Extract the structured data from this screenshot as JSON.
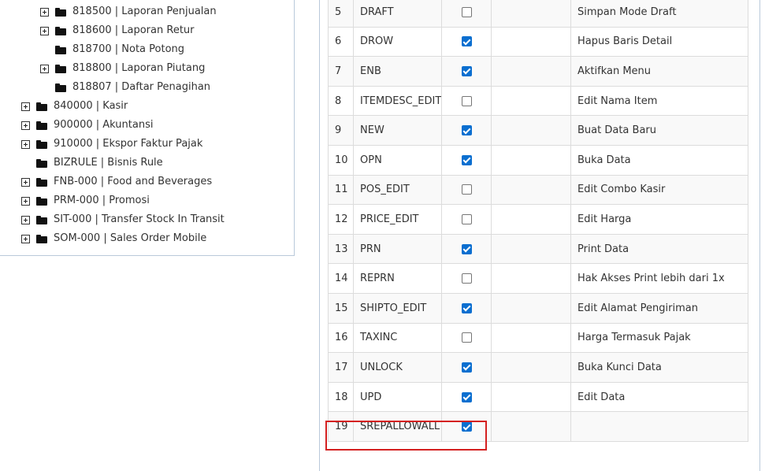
{
  "tree": {
    "nodes": [
      {
        "label": "818500 | Laporan Penjualan",
        "expandable": true,
        "level": 1
      },
      {
        "label": "818600 | Laporan Retur",
        "expandable": true,
        "level": 1
      },
      {
        "label": "818700 | Nota Potong",
        "expandable": false,
        "level": 1
      },
      {
        "label": "818800 | Laporan Piutang",
        "expandable": true,
        "level": 1
      },
      {
        "label": "818807 | Daftar Penagihan",
        "expandable": false,
        "level": 1
      },
      {
        "label": "840000 | Kasir",
        "expandable": true,
        "level": 0
      },
      {
        "label": "900000 | Akuntansi",
        "expandable": true,
        "level": 0
      },
      {
        "label": "910000 | Ekspor Faktur Pajak",
        "expandable": true,
        "level": 0
      },
      {
        "label": "BIZRULE | Bisnis Rule",
        "expandable": false,
        "level": 0
      },
      {
        "label": "FNB-000 | Food and Beverages",
        "expandable": true,
        "level": 0
      },
      {
        "label": "PRM-000 | Promosi",
        "expandable": true,
        "level": 0
      },
      {
        "label": "SIT-000 | Transfer Stock In Transit",
        "expandable": true,
        "level": 0
      },
      {
        "label": "SOM-000 | Sales Order Mobile",
        "expandable": true,
        "level": 0
      }
    ]
  },
  "permissions": {
    "rows": [
      {
        "no": "5",
        "code": "DRAFT",
        "checked": false,
        "desc": "Simpan Mode Draft"
      },
      {
        "no": "6",
        "code": "DROW",
        "checked": true,
        "desc": "Hapus Baris Detail"
      },
      {
        "no": "7",
        "code": "ENB",
        "checked": true,
        "desc": "Aktifkan Menu"
      },
      {
        "no": "8",
        "code": "ITEMDESC_EDIT",
        "checked": false,
        "desc": "Edit Nama Item"
      },
      {
        "no": "9",
        "code": "NEW",
        "checked": true,
        "desc": "Buat Data Baru"
      },
      {
        "no": "10",
        "code": "OPN",
        "checked": true,
        "desc": "Buka Data"
      },
      {
        "no": "11",
        "code": "POS_EDIT",
        "checked": false,
        "desc": "Edit Combo Kasir"
      },
      {
        "no": "12",
        "code": "PRICE_EDIT",
        "checked": false,
        "desc": "Edit Harga"
      },
      {
        "no": "13",
        "code": "PRN",
        "checked": true,
        "desc": "Print Data"
      },
      {
        "no": "14",
        "code": "REPRN",
        "checked": false,
        "desc": "Hak Akses Print lebih dari 1x"
      },
      {
        "no": "15",
        "code": "SHIPTO_EDIT",
        "checked": true,
        "desc": "Edit Alamat Pengiriman"
      },
      {
        "no": "16",
        "code": "TAXINC",
        "checked": false,
        "desc": "Harga Termasuk Pajak"
      },
      {
        "no": "17",
        "code": "UNLOCK",
        "checked": true,
        "desc": "Buka Kunci Data"
      },
      {
        "no": "18",
        "code": "UPD",
        "checked": true,
        "desc": "Edit Data"
      },
      {
        "no": "19",
        "code": "SREPALLOWALL",
        "checked": true,
        "desc": ""
      }
    ],
    "highlighted_row": "19",
    "highlight_color": "#d42020",
    "checkbox_color": "#0b6fd0"
  }
}
